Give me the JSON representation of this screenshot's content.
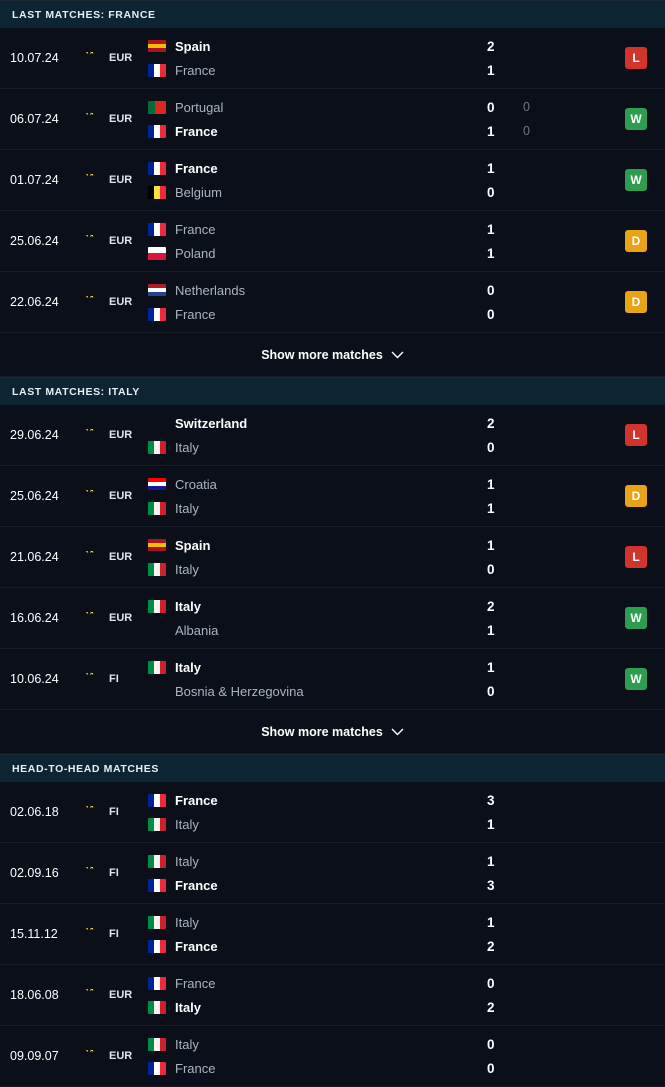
{
  "sections": [
    {
      "id": "last-matches-france",
      "title": "LAST MATCHES: FRANCE",
      "show_more_label": "Show more matches",
      "matches": [
        {
          "date": "10.07.24",
          "competition": "EUR",
          "home": {
            "name": "Spain",
            "flag": "es",
            "winner": true
          },
          "away": {
            "name": "France",
            "flag": "fr",
            "winner": false
          },
          "home_score": "2",
          "away_score": "1",
          "home_score_alt": "",
          "away_score_alt": "",
          "result": "L"
        },
        {
          "date": "06.07.24",
          "competition": "EUR",
          "home": {
            "name": "Portugal",
            "flag": "pt",
            "winner": false
          },
          "away": {
            "name": "France",
            "flag": "fr",
            "winner": true
          },
          "home_score": "0",
          "away_score": "1",
          "home_score_alt": "0",
          "away_score_alt": "0",
          "result": "W"
        },
        {
          "date": "01.07.24",
          "competition": "EUR",
          "home": {
            "name": "France",
            "flag": "fr",
            "winner": true
          },
          "away": {
            "name": "Belgium",
            "flag": "be",
            "winner": false
          },
          "home_score": "1",
          "away_score": "0",
          "home_score_alt": "",
          "away_score_alt": "",
          "result": "W"
        },
        {
          "date": "25.06.24",
          "competition": "EUR",
          "home": {
            "name": "France",
            "flag": "fr",
            "winner": false
          },
          "away": {
            "name": "Poland",
            "flag": "pl",
            "winner": false
          },
          "home_score": "1",
          "away_score": "1",
          "home_score_alt": "",
          "away_score_alt": "",
          "result": "D"
        },
        {
          "date": "22.06.24",
          "competition": "EUR",
          "home": {
            "name": "Netherlands",
            "flag": "nl",
            "winner": false
          },
          "away": {
            "name": "France",
            "flag": "fr",
            "winner": false
          },
          "home_score": "0",
          "away_score": "0",
          "home_score_alt": "",
          "away_score_alt": "",
          "result": "D"
        }
      ]
    },
    {
      "id": "last-matches-italy",
      "title": "LAST MATCHES: ITALY",
      "show_more_label": "Show more matches",
      "matches": [
        {
          "date": "29.06.24",
          "competition": "EUR",
          "home": {
            "name": "Switzerland",
            "flag": "ch",
            "winner": true
          },
          "away": {
            "name": "Italy",
            "flag": "it",
            "winner": false
          },
          "home_score": "2",
          "away_score": "0",
          "home_score_alt": "",
          "away_score_alt": "",
          "result": "L"
        },
        {
          "date": "25.06.24",
          "competition": "EUR",
          "home": {
            "name": "Croatia",
            "flag": "hr",
            "winner": false
          },
          "away": {
            "name": "Italy",
            "flag": "it",
            "winner": false
          },
          "home_score": "1",
          "away_score": "1",
          "home_score_alt": "",
          "away_score_alt": "",
          "result": "D"
        },
        {
          "date": "21.06.24",
          "competition": "EUR",
          "home": {
            "name": "Spain",
            "flag": "es",
            "winner": true
          },
          "away": {
            "name": "Italy",
            "flag": "it",
            "winner": false
          },
          "home_score": "1",
          "away_score": "0",
          "home_score_alt": "",
          "away_score_alt": "",
          "result": "L"
        },
        {
          "date": "16.06.24",
          "competition": "EUR",
          "home": {
            "name": "Italy",
            "flag": "it",
            "winner": true
          },
          "away": {
            "name": "Albania",
            "flag": "al",
            "winner": false
          },
          "home_score": "2",
          "away_score": "1",
          "home_score_alt": "",
          "away_score_alt": "",
          "result": "W"
        },
        {
          "date": "10.06.24",
          "competition": "FI",
          "home": {
            "name": "Italy",
            "flag": "it",
            "winner": true
          },
          "away": {
            "name": "Bosnia & Herzegovina",
            "flag": "ba",
            "winner": false
          },
          "home_score": "1",
          "away_score": "0",
          "home_score_alt": "",
          "away_score_alt": "",
          "result": "W"
        }
      ]
    },
    {
      "id": "head-to-head-matches",
      "title": "HEAD-TO-HEAD MATCHES",
      "show_more_label": "",
      "matches": [
        {
          "date": "02.06.18",
          "competition": "FI",
          "home": {
            "name": "France",
            "flag": "fr",
            "winner": true
          },
          "away": {
            "name": "Italy",
            "flag": "it",
            "winner": false
          },
          "home_score": "3",
          "away_score": "1",
          "home_score_alt": "",
          "away_score_alt": "",
          "result": ""
        },
        {
          "date": "02.09.16",
          "competition": "FI",
          "home": {
            "name": "Italy",
            "flag": "it",
            "winner": false
          },
          "away": {
            "name": "France",
            "flag": "fr",
            "winner": true
          },
          "home_score": "1",
          "away_score": "3",
          "home_score_alt": "",
          "away_score_alt": "",
          "result": ""
        },
        {
          "date": "15.11.12",
          "competition": "FI",
          "home": {
            "name": "Italy",
            "flag": "it",
            "winner": false
          },
          "away": {
            "name": "France",
            "flag": "fr",
            "winner": true
          },
          "home_score": "1",
          "away_score": "2",
          "home_score_alt": "",
          "away_score_alt": "",
          "result": ""
        },
        {
          "date": "18.06.08",
          "competition": "EUR",
          "home": {
            "name": "France",
            "flag": "fr",
            "winner": false
          },
          "away": {
            "name": "Italy",
            "flag": "it",
            "winner": true
          },
          "home_score": "0",
          "away_score": "2",
          "home_score_alt": "",
          "away_score_alt": "",
          "result": ""
        },
        {
          "date": "09.09.07",
          "competition": "EUR",
          "home": {
            "name": "Italy",
            "flag": "it",
            "winner": false
          },
          "away": {
            "name": "France",
            "flag": "fr",
            "winner": false
          },
          "home_score": "0",
          "away_score": "0",
          "home_score_alt": "",
          "away_score_alt": "",
          "result": ""
        }
      ]
    }
  ],
  "colors": {
    "win": "#2d9e4f",
    "draw": "#e8a317",
    "loss": "#d0342c",
    "header_bg": "#0d2433",
    "page_bg": "#0b0f19"
  }
}
